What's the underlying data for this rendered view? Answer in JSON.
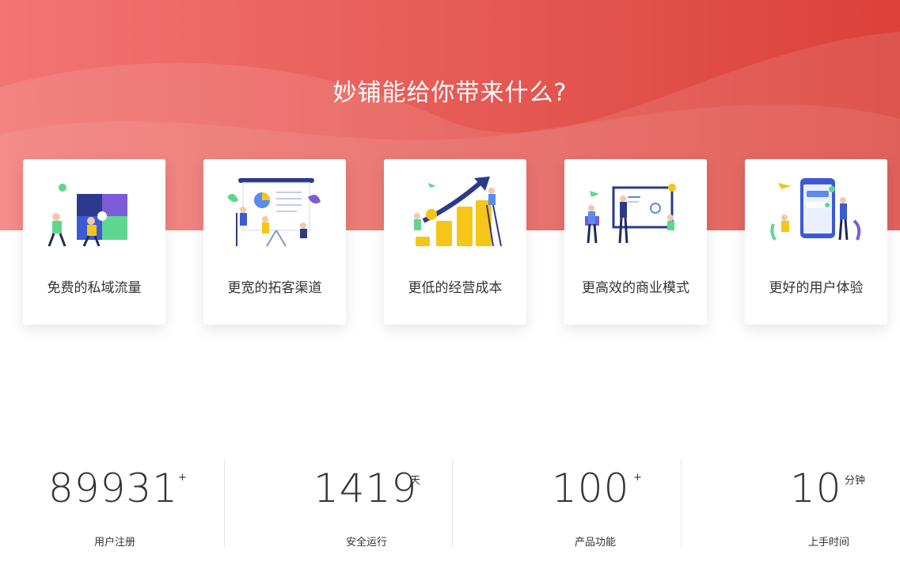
{
  "hero": {
    "title": "妙铺能给你带来什么?",
    "gradient_start": "#f27a79",
    "gradient_end": "#d9433b"
  },
  "cards": [
    {
      "label": "免费的私域流量",
      "illustration": "puzzle-team-icon"
    },
    {
      "label": "更宽的拓客渠道",
      "illustration": "presentation-board-icon"
    },
    {
      "label": "更低的经营成本",
      "illustration": "coin-growth-icon"
    },
    {
      "label": "更高效的商业模式",
      "illustration": "dashboard-screen-icon"
    },
    {
      "label": "更好的用户体验",
      "illustration": "mobile-app-icon"
    }
  ],
  "stats": [
    {
      "value": "89931",
      "unit": "+",
      "caption": "用户注册"
    },
    {
      "value": "1419",
      "unit": "天",
      "caption": "安全运行"
    },
    {
      "value": "100",
      "unit": "+",
      "caption": "产品功能"
    },
    {
      "value": "10",
      "unit": "分钟",
      "caption": "上手时间"
    }
  ]
}
